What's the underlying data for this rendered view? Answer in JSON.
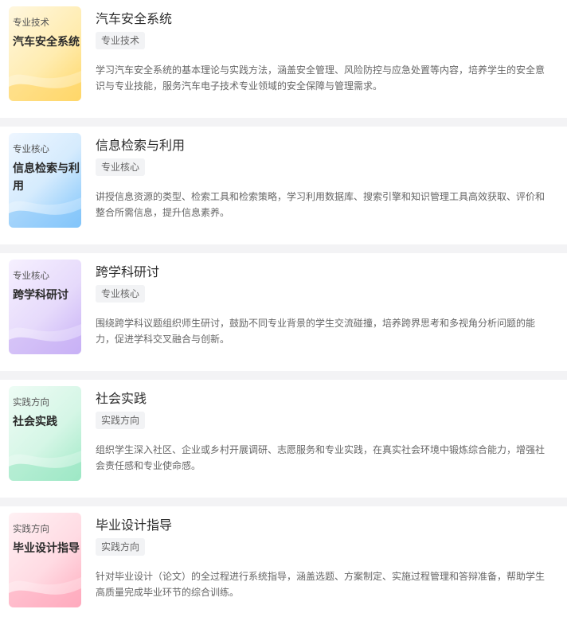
{
  "courses": [
    {
      "thumb_category": "专业技术",
      "thumb_name": "汽车安全系统",
      "title": "汽车安全系统",
      "tag": "专业技术",
      "description": "学习汽车安全系统的基本理论与实践方法，涵盖安全管理、风险防控与应急处置等内容，培养学生的安全意识与专业技能，服务汽车电子技术专业领域的安全保障与管理需求。",
      "theme_color": "#ffd766"
    },
    {
      "thumb_category": "专业核心",
      "thumb_name": "信息检索与利用",
      "title": "信息检索与利用",
      "tag": "专业核心",
      "description": "讲授信息资源的类型、检索工具和检索策略，学习利用数据库、搜索引擎和知识管理工具高效获取、评价和整合所需信息，提升信息素养。",
      "theme_color": "#7ec4fb"
    },
    {
      "thumb_category": "专业核心",
      "thumb_name": "跨学科研讨",
      "title": "跨学科研讨",
      "tag": "专业核心",
      "description": "围绕跨学科议题组织师生研讨，鼓励不同专业背景的学生交流碰撞，培养跨界思考和多视角分析问题的能力，促进学科交叉融合与创新。",
      "theme_color": "#c7b0f6"
    },
    {
      "thumb_category": "实践方向",
      "thumb_name": "社会实践",
      "title": "社会实践",
      "tag": "实践方向",
      "description": "组织学生深入社区、企业或乡村开展调研、志愿服务和专业实践，在真实社会环境中锻炼综合能力，增强社会责任感和专业使命感。",
      "theme_color": "#9fe9c6"
    },
    {
      "thumb_category": "实践方向",
      "thumb_name": "毕业设计指导",
      "title": "毕业设计指导",
      "tag": "实践方向",
      "description": "针对毕业设计（论文）的全过程进行系统指导，涵盖选题、方案制定、实施过程管理和答辩准备，帮助学生高质量完成毕业环节的综合训练。",
      "theme_color": "#ffadbf"
    }
  ]
}
